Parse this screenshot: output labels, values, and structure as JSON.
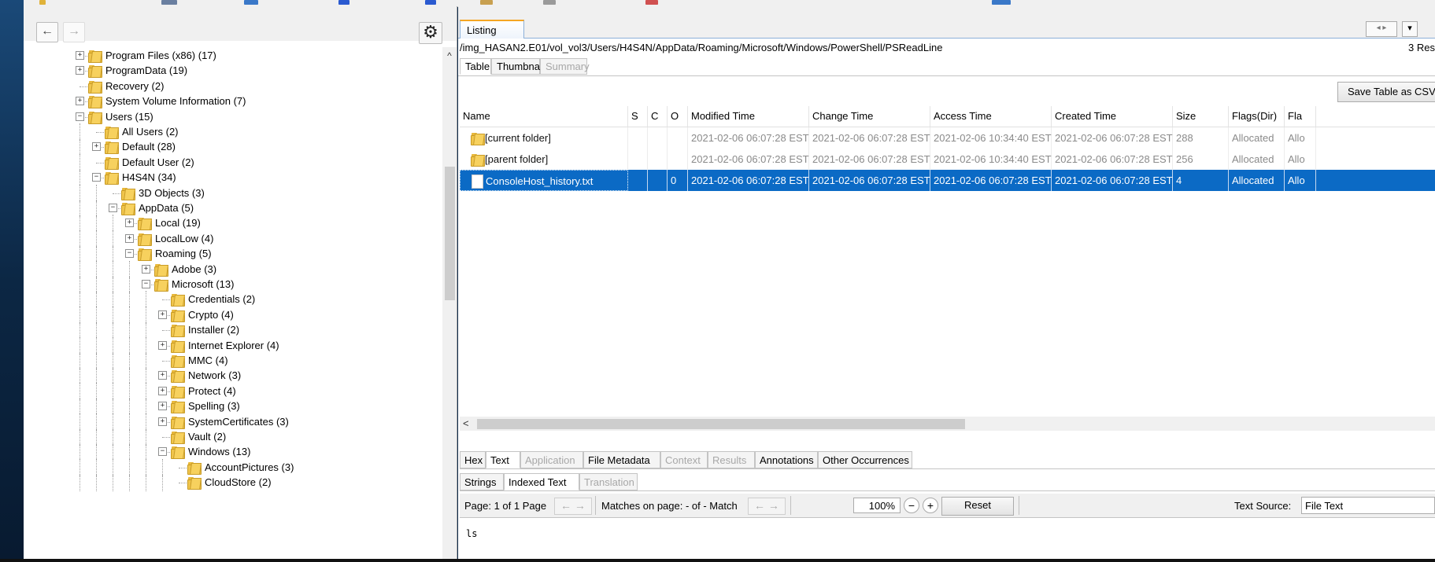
{
  "left_panel": {
    "nav_back": "←",
    "nav_forward": "→",
    "settings": "⚙",
    "scroll_up": "^",
    "tree": [
      {
        "label": "Program Files (x86) (17)",
        "depth": 3,
        "expander": "+"
      },
      {
        "label": "ProgramData (19)",
        "depth": 3,
        "expander": "+"
      },
      {
        "label": "Recovery (2)",
        "depth": 3,
        "expander": ""
      },
      {
        "label": "System Volume Information (7)",
        "depth": 3,
        "expander": "+"
      },
      {
        "label": "Users (15)",
        "depth": 3,
        "expander": "−"
      },
      {
        "label": "All Users (2)",
        "depth": 4,
        "expander": ""
      },
      {
        "label": "Default (28)",
        "depth": 4,
        "expander": "+"
      },
      {
        "label": "Default User (2)",
        "depth": 4,
        "expander": ""
      },
      {
        "label": "H4S4N (34)",
        "depth": 4,
        "expander": "−"
      },
      {
        "label": "3D Objects (3)",
        "depth": 5,
        "expander": ""
      },
      {
        "label": "AppData (5)",
        "depth": 5,
        "expander": "−"
      },
      {
        "label": "Local (19)",
        "depth": 6,
        "expander": "+"
      },
      {
        "label": "LocalLow (4)",
        "depth": 6,
        "expander": "+"
      },
      {
        "label": "Roaming (5)",
        "depth": 6,
        "expander": "−"
      },
      {
        "label": "Adobe (3)",
        "depth": 7,
        "expander": "+"
      },
      {
        "label": "Microsoft (13)",
        "depth": 7,
        "expander": "−"
      },
      {
        "label": "Credentials (2)",
        "depth": 8,
        "expander": ""
      },
      {
        "label": "Crypto (4)",
        "depth": 8,
        "expander": "+"
      },
      {
        "label": "Installer (2)",
        "depth": 8,
        "expander": ""
      },
      {
        "label": "Internet Explorer (4)",
        "depth": 8,
        "expander": "+"
      },
      {
        "label": "MMC (4)",
        "depth": 8,
        "expander": ""
      },
      {
        "label": "Network (3)",
        "depth": 8,
        "expander": "+"
      },
      {
        "label": "Protect (4)",
        "depth": 8,
        "expander": "+"
      },
      {
        "label": "Spelling (3)",
        "depth": 8,
        "expander": "+"
      },
      {
        "label": "SystemCertificates (3)",
        "depth": 8,
        "expander": "+"
      },
      {
        "label": "Vault (2)",
        "depth": 8,
        "expander": ""
      },
      {
        "label": "Windows (13)",
        "depth": 8,
        "expander": "−"
      },
      {
        "label": "AccountPictures (3)",
        "depth": 9,
        "expander": ""
      },
      {
        "label": "CloudStore (2)",
        "depth": 9,
        "expander": ""
      }
    ]
  },
  "right_panel": {
    "listing_tab": "Listing",
    "path": "/img_HASAN2.E01/vol_vol3/Users/H4S4N/AppData/Roaming/Microsoft/Windows/PowerShell/PSReadLine",
    "results_count": "3  Res",
    "view_tabs": [
      "Table",
      "Thumbnail",
      "Summary"
    ],
    "save_csv": "Save Table as CSV",
    "columns": [
      "Name",
      "S",
      "C",
      "O",
      "Modified Time",
      "Change Time",
      "Access Time",
      "Created Time",
      "Size",
      "Flags(Dir)",
      "Fla"
    ],
    "rows": [
      {
        "type": "folder",
        "name": "[current folder]",
        "s": "",
        "c": "",
        "o": "",
        "modified": "2021-02-06 06:07:28 EST",
        "change": "2021-02-06 06:07:28 EST",
        "access": "2021-02-06 10:34:40 EST",
        "created": "2021-02-06 06:07:28 EST",
        "size": "288",
        "flags_dir": "Allocated",
        "flags_meta": "Allo"
      },
      {
        "type": "folder",
        "name": "[parent folder]",
        "s": "",
        "c": "",
        "o": "",
        "modified": "2021-02-06 06:07:28 EST",
        "change": "2021-02-06 06:07:28 EST",
        "access": "2021-02-06 10:34:40 EST",
        "created": "2021-02-06 06:07:28 EST",
        "size": "256",
        "flags_dir": "Allocated",
        "flags_meta": "Allo"
      },
      {
        "type": "file",
        "name": "ConsoleHost_history.txt",
        "s": "",
        "c": "",
        "o": "0",
        "modified": "2021-02-06 06:07:28 EST",
        "change": "2021-02-06 06:07:28 EST",
        "access": "2021-02-06 06:07:28 EST",
        "created": "2021-02-06 06:07:28 EST",
        "size": "4",
        "flags_dir": "Allocated",
        "flags_meta": "Allo"
      }
    ],
    "hscroll_left": "<",
    "content_tabs": [
      "Hex",
      "Text",
      "Application",
      "File Metadata",
      "Context",
      "Results",
      "Annotations",
      "Other Occurrences"
    ],
    "text_subtabs": [
      "Strings",
      "Indexed Text",
      "Translation"
    ],
    "page_label": "Page:  1  of  1  Page",
    "matches_label": "Matches on page:  -  of  -  Match",
    "zoom": "100%",
    "zoom_out": "−",
    "zoom_in": "+",
    "reset": "Reset",
    "text_source_label": "Text Source:",
    "text_source_value": "File Text",
    "content_text": "ls"
  }
}
